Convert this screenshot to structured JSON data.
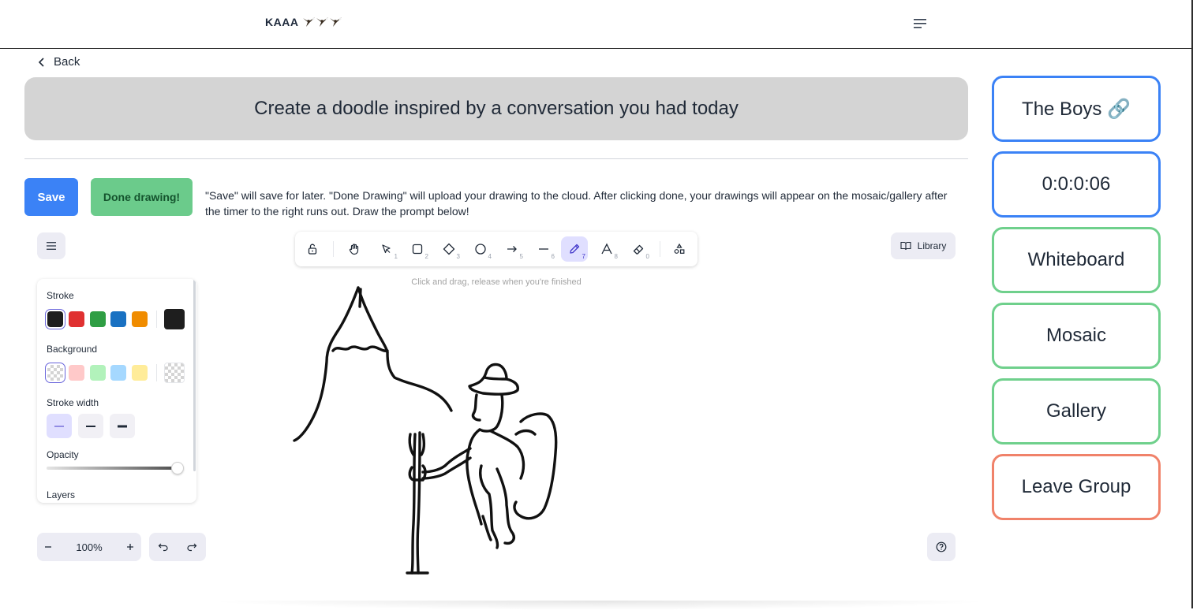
{
  "header": {
    "brand": "KAAA",
    "brand_icons": [
      "eagle-icon",
      "eagle-icon",
      "eagle-icon"
    ],
    "menu_icon": "hamburger-icon"
  },
  "nav": {
    "back_label": "Back"
  },
  "prompt": {
    "text": "Create a doodle inspired by a conversation you had today"
  },
  "actions": {
    "save_label": "Save",
    "done_label": "Done drawing!",
    "instructions": "\"Save\" will save for later. \"Done Drawing\" will upload your drawing to the cloud. After clicking done, your drawings will appear on the mosaic/gallery after the timer to the right runs out. Draw the prompt below!"
  },
  "editor": {
    "toolbar": {
      "tools": [
        {
          "name": "lock",
          "icon": "lock-icon",
          "shortcut": ""
        },
        {
          "name": "hand",
          "icon": "hand-icon",
          "shortcut": ""
        },
        {
          "name": "selection",
          "icon": "pointer-icon",
          "shortcut": "1"
        },
        {
          "name": "rectangle",
          "icon": "square-icon",
          "shortcut": "2"
        },
        {
          "name": "diamond",
          "icon": "diamond-icon",
          "shortcut": "3"
        },
        {
          "name": "ellipse",
          "icon": "circle-icon",
          "shortcut": "4"
        },
        {
          "name": "arrow",
          "icon": "arrow-icon",
          "shortcut": "5"
        },
        {
          "name": "line",
          "icon": "line-icon",
          "shortcut": "6"
        },
        {
          "name": "draw",
          "icon": "pencil-icon",
          "shortcut": "7",
          "active": true
        },
        {
          "name": "text",
          "icon": "text-icon",
          "shortcut": "8"
        },
        {
          "name": "eraser",
          "icon": "eraser-icon",
          "shortcut": "0"
        },
        {
          "name": "extra-tools",
          "icon": "shapes-icon",
          "shortcut": ""
        }
      ]
    },
    "hint": "Click and drag, release when you're finished",
    "library_label": "Library",
    "properties": {
      "stroke_label": "Stroke",
      "stroke_colors": [
        "#1e1e1e",
        "#e03131",
        "#2f9e44",
        "#1971c2",
        "#f08c00"
      ],
      "stroke_current": "#1e1e1e",
      "background_label": "Background",
      "background_colors": [
        "transparent",
        "#ffc9c9",
        "#b2f2bb",
        "#a5d8ff",
        "#ffec99"
      ],
      "background_current": "transparent",
      "stroke_width_label": "Stroke width",
      "opacity_label": "Opacity",
      "opacity_value": 100,
      "layers_label": "Layers"
    },
    "zoom": {
      "value": "100%"
    }
  },
  "sidebar": {
    "group_name": "The Boys 🔗",
    "timer": "0:0:0:06",
    "whiteboard": "Whiteboard",
    "mosaic": "Mosaic",
    "gallery": "Gallery",
    "leave": "Leave Group",
    "colors": {
      "primary": "#3b82f6",
      "nav": "#6fd08c",
      "danger": "#f0826a"
    }
  }
}
